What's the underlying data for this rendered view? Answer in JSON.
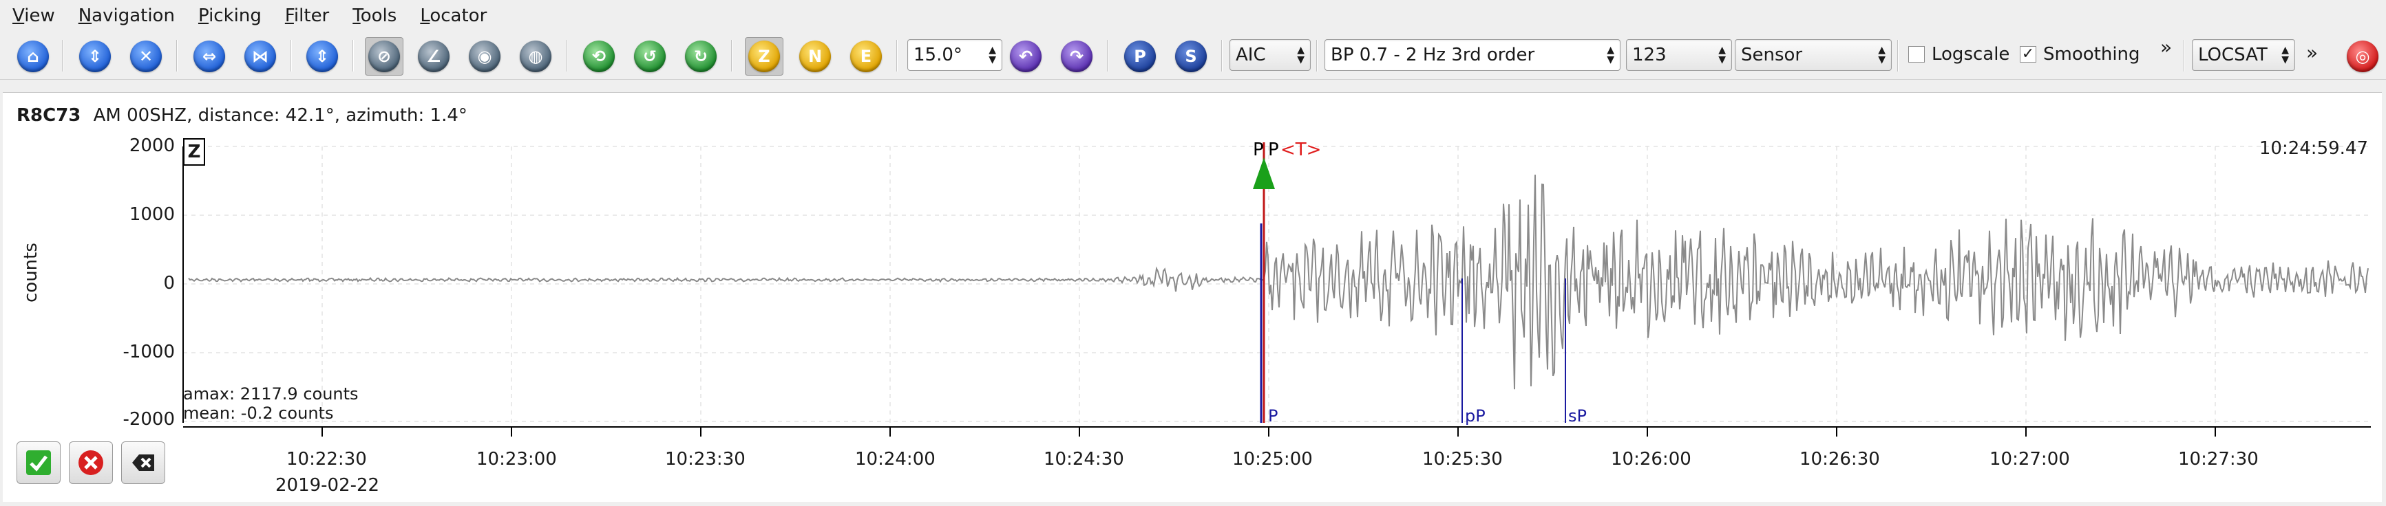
{
  "menu": [
    "View",
    "Navigation",
    "Picking",
    "Filter",
    "Tools",
    "Locator"
  ],
  "toolbar": {
    "rotation_value": "15.0°",
    "picker_method": "AIC",
    "filter": "BP 0.7 - 2 Hz  3rd order",
    "component_mode": "123",
    "unit_mode": "Sensor",
    "logscale_label": "Logscale",
    "logscale_checked": false,
    "smoothing_label": "Smoothing",
    "smoothing_checked": true,
    "locator": "LOCSAT",
    "overflow_glyph": "»",
    "btn_z": "Z",
    "btn_n": "N",
    "btn_e": "E",
    "btn_p": "P",
    "btn_s": "S"
  },
  "trace": {
    "station": "R8C73",
    "network_channel": "AM  00SHZ",
    "distance_azimuth": ", distance: 42.1°, azimuth: 1.4°",
    "component": "Z",
    "y_unit": "counts",
    "y_ticks": [
      "2000",
      "1000",
      "0",
      "-1000",
      "-2000"
    ],
    "x_ticks": [
      "10:22:30",
      "10:23:00",
      "10:23:30",
      "10:24:00",
      "10:24:30",
      "10:25:00",
      "10:25:30",
      "10:26:00",
      "10:26:30",
      "10:27:00",
      "10:27:30"
    ],
    "date": "2019-02-22",
    "end_time": "10:24:59.47",
    "amax": "amax: 2117.9 counts",
    "mean": "mean: -0.2 counts",
    "pick_top_1": "P",
    "pick_top_2": "P",
    "pick_top_t": "<T>",
    "pick_p": "P",
    "pick_pp": "pP",
    "pick_sp": "sP"
  },
  "colors": {
    "trace": "#8a8a8a",
    "pick_red": "#c01818",
    "pick_blue": "#1a1aa0",
    "arrow_green": "#1aa01a",
    "grid": "#d6d6d6"
  }
}
